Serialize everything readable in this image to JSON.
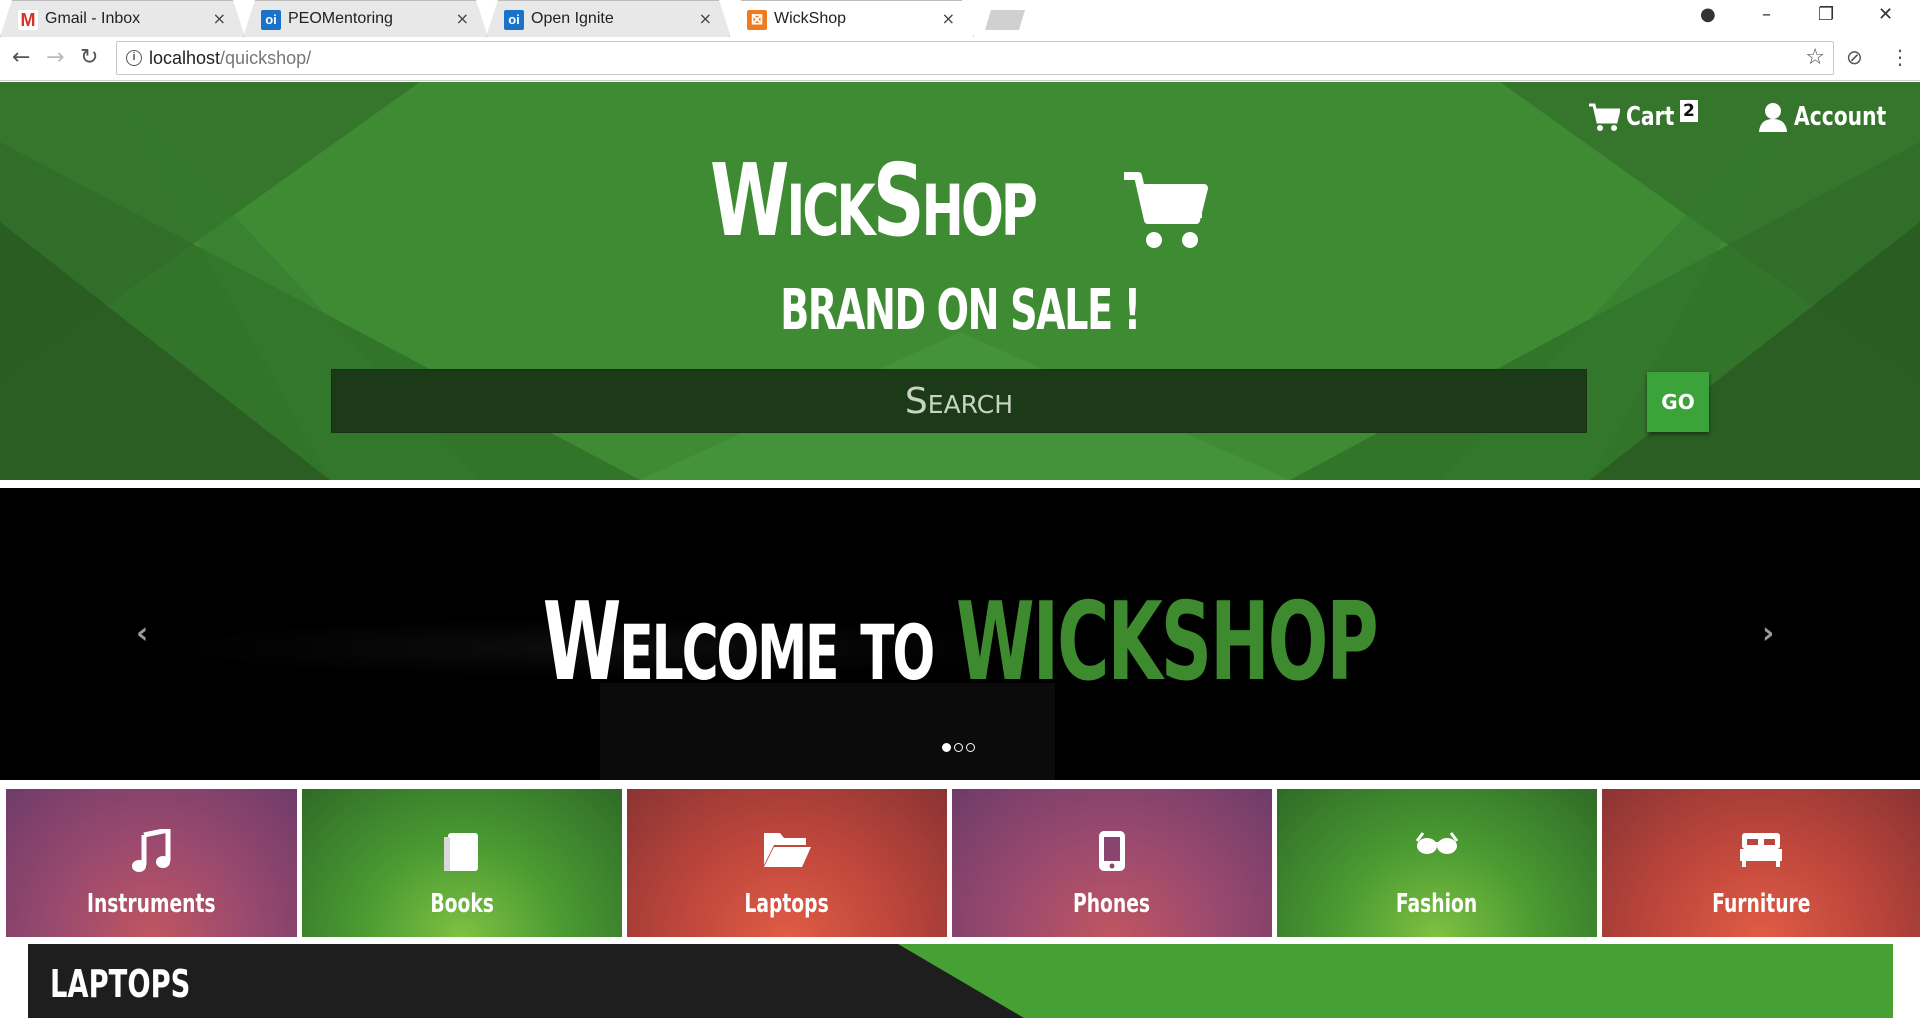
{
  "browser": {
    "tabs": [
      {
        "label": "Gmail - Inbox",
        "icon": "gmail-icon",
        "icon_text": "M",
        "icon_color": "#d93025",
        "active": false
      },
      {
        "label": "PEOMentoring",
        "icon": "outlook-icon",
        "icon_text": "oi",
        "icon_color": "#1a73c9",
        "active": false
      },
      {
        "label": "Open Ignite",
        "icon": "outlook-icon",
        "icon_text": "oi",
        "icon_color": "#1a73c9",
        "active": false
      },
      {
        "label": "WickShop",
        "icon": "xampp-icon",
        "icon_text": "⊠",
        "icon_color": "#f07b1e",
        "active": true
      }
    ],
    "close_glyph": "×",
    "url_host": "localhost",
    "url_path": "/quickshop/"
  },
  "header": {
    "brand": "WickShop",
    "tagline": "BRAND ON SALE !",
    "search_placeholder": "Search",
    "go_label": "GO",
    "cart_label": "Cart",
    "cart_count": "2",
    "account_label": "Account"
  },
  "carousel": {
    "welcome_prefix": "Welcome to ",
    "welcome_brand": "WICKSHOP",
    "prev_glyph": "‹",
    "next_glyph": "›",
    "slide_count": 3,
    "active_slide": 0
  },
  "categories": [
    {
      "label": "Instruments",
      "icon": "music-note-icon",
      "theme": "purple"
    },
    {
      "label": "Books",
      "icon": "book-icon",
      "theme": "green"
    },
    {
      "label": "Laptops",
      "icon": "folder-open-icon",
      "theme": "red"
    },
    {
      "label": "Phones",
      "icon": "phone-icon",
      "theme": "purple"
    },
    {
      "label": "Fashion",
      "icon": "sunglasses-icon",
      "theme": "green"
    },
    {
      "label": "Furniture",
      "icon": "bed-icon",
      "theme": "red"
    }
  ],
  "section": {
    "title": "LAPTOPS"
  },
  "colors": {
    "hero_green": "#3f8b34",
    "accent_green": "#3e8b2f",
    "go_button": "#3aa33a",
    "section_dark": "#1e1e1e",
    "section_green": "#46a033"
  }
}
